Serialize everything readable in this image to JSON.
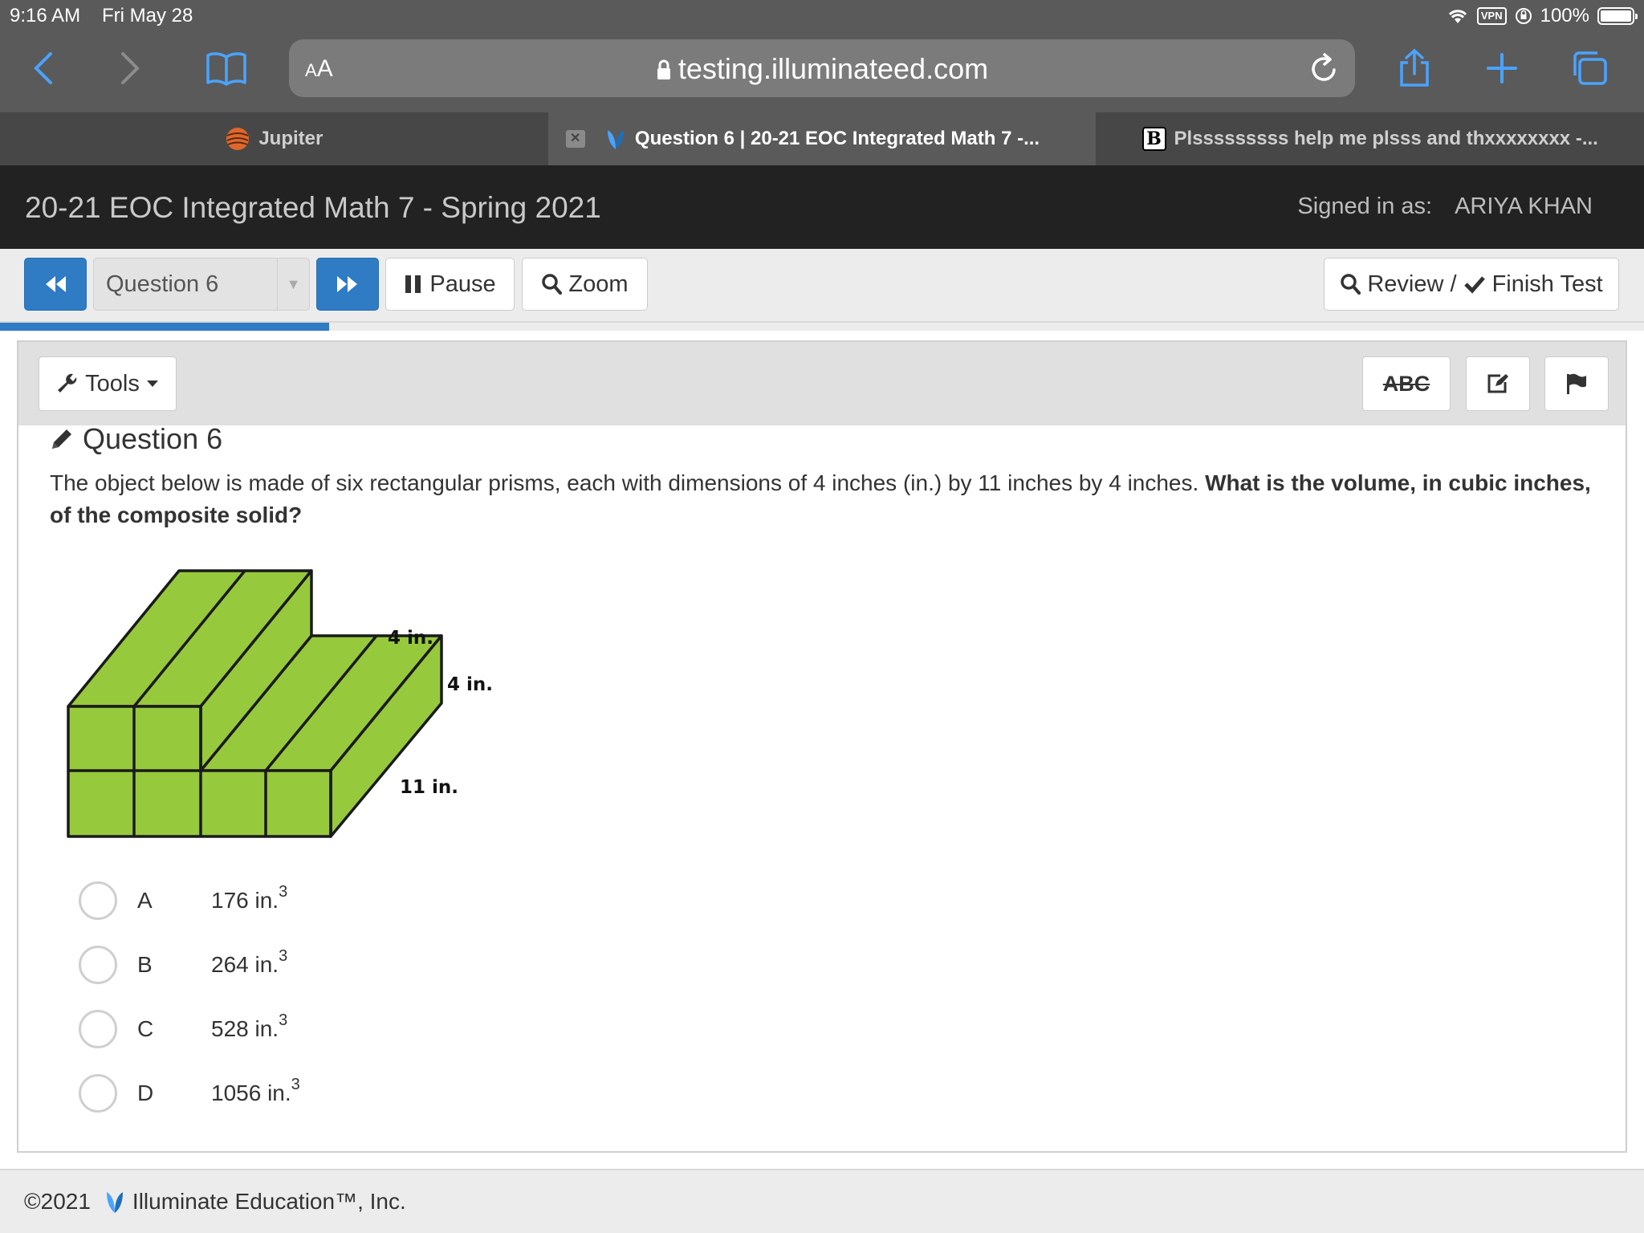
{
  "status": {
    "time": "9:16 AM",
    "date": "Fri May 28",
    "vpn": "VPN",
    "battery": "100%"
  },
  "browser": {
    "aa_small": "A",
    "aa_big": "A",
    "url": "testing.illuminateed.com"
  },
  "tabs": [
    {
      "label": "Jupiter"
    },
    {
      "label": "Question 6 | 20-21 EOC Integrated Math 7 -..."
    },
    {
      "label": "Plsssssssss help me plsss and thxxxxxxxx -..."
    }
  ],
  "header": {
    "title": "20-21 EOC Integrated Math 7 - Spring 2021",
    "signed_label": "Signed in as:",
    "user": "ARIYA KHAN"
  },
  "toolbar": {
    "question_select": "Question 6",
    "pause": "Pause",
    "zoom": "Zoom",
    "review": "Review /",
    "finish": "Finish Test",
    "progress_fraction": 0.2
  },
  "panel": {
    "tools": "Tools",
    "abc": "ABC"
  },
  "question": {
    "title": "Question 6",
    "text_plain": "The object below is made of six rectangular prisms, each with dimensions of 4 inches (in.) by 11 inches by 4 inches. ",
    "text_bold": "What is the volume, in cubic inches, of the composite solid?",
    "figure_labels": {
      "top": "4 in.",
      "side": "4 in.",
      "depth": "11 in."
    },
    "figure_color": "#97c93d"
  },
  "choices": [
    {
      "letter": "A",
      "value": "176 in.",
      "exp": "3"
    },
    {
      "letter": "B",
      "value": "264 in.",
      "exp": "3"
    },
    {
      "letter": "C",
      "value": "528 in.",
      "exp": "3"
    },
    {
      "letter": "D",
      "value": "1056 in.",
      "exp": "3"
    }
  ],
  "footer": {
    "text": "©2021",
    "company": "Illuminate Education™, Inc."
  }
}
